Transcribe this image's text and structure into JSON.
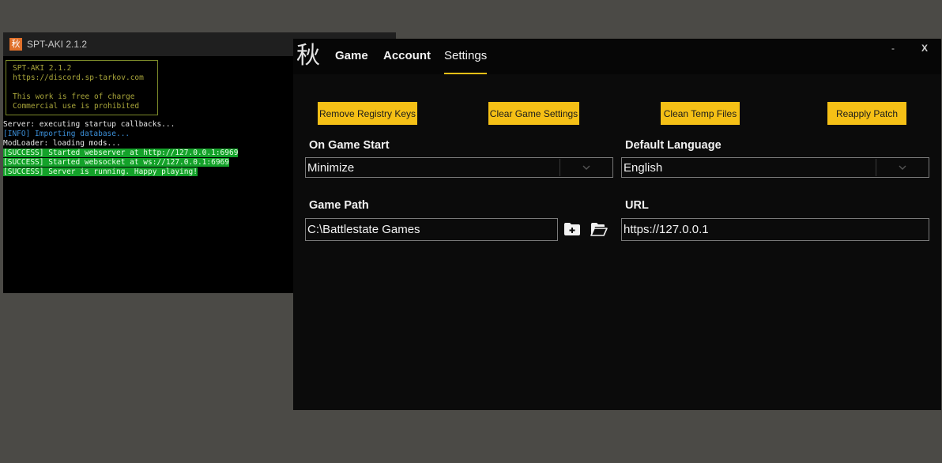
{
  "console": {
    "title": "SPT-AKI 2.1.2",
    "app_icon_glyph": "秋",
    "banner": [
      "SPT-AKI 2.1.2",
      "https://discord.sp-tarkov.com",
      "",
      "This work is free of charge",
      "Commercial use is prohibited"
    ],
    "lines": [
      {
        "type": "normal",
        "text": "Server: executing startup callbacks..."
      },
      {
        "type": "info",
        "text": "[INFO] Importing database..."
      },
      {
        "type": "normal",
        "text": "ModLoader: loading mods..."
      },
      {
        "type": "success",
        "text": "[SUCCESS] Started webserver at http://127.0.0.1:6969"
      },
      {
        "type": "success",
        "text": "[SUCCESS] Started websocket at ws://127.0.0.1:6969"
      },
      {
        "type": "success",
        "text": "[SUCCESS] Server is running. Happy playing!"
      }
    ]
  },
  "launcher": {
    "logo": "秋",
    "tabs": {
      "game": "Game",
      "account": "Account",
      "settings": "Settings"
    },
    "window_controls": {
      "minimize": "-",
      "close": "X"
    },
    "buttons": {
      "remove_registry": "Remove Registry Keys",
      "clear_game_settings": "Clear Game Settings",
      "clean_temp": "Clean Temp Files",
      "reapply_patch": "Reapply Patch"
    },
    "on_game_start": {
      "label": "On Game Start",
      "value": "Minimize"
    },
    "default_language": {
      "label": "Default Language",
      "value": "English"
    },
    "game_path": {
      "label": "Game Path",
      "value": "C:\\Battlestate Games"
    },
    "url": {
      "label": "URL",
      "value": "https://127.0.0.1"
    }
  },
  "colors": {
    "accent": "#f5c016",
    "success": "#14a22a",
    "info": "#3b8fd8",
    "banner": "#a8a53a"
  }
}
